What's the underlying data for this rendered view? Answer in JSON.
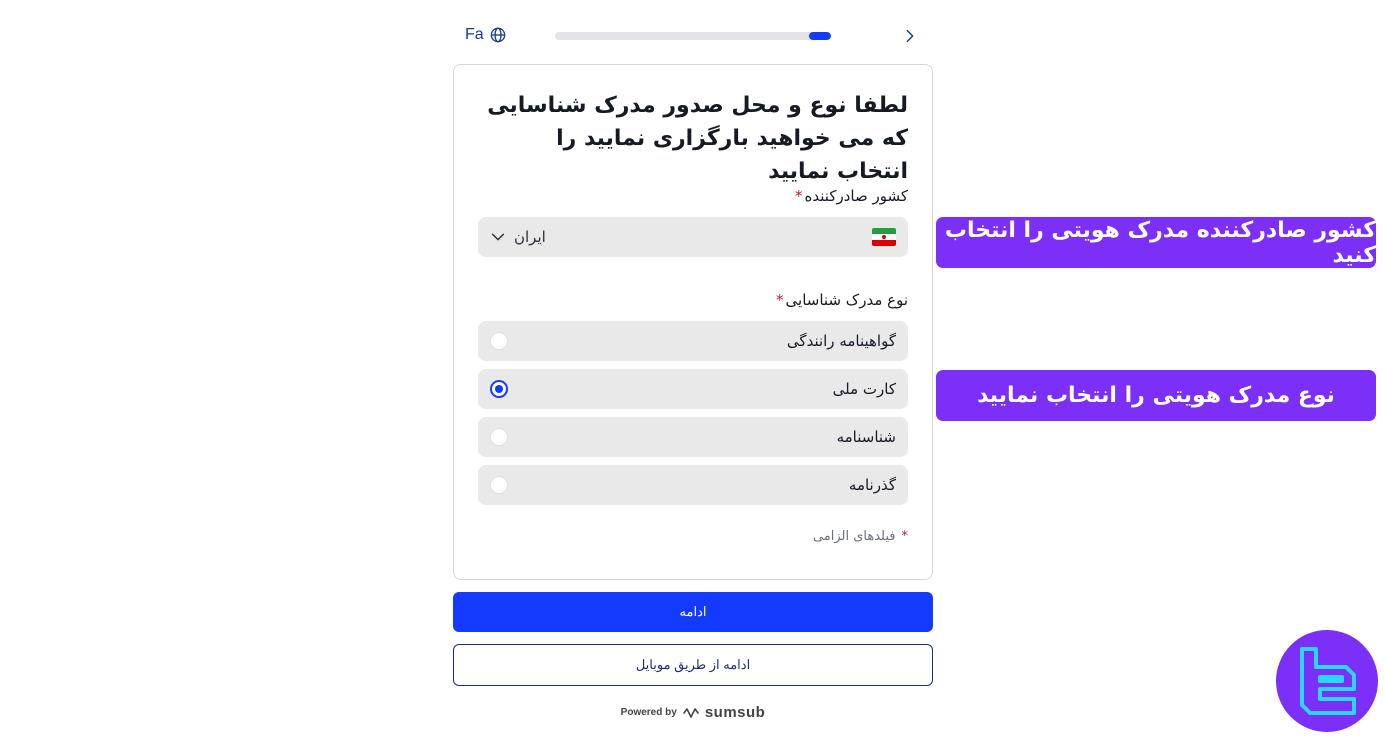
{
  "header": {
    "language_label": "Fa",
    "language_icon": "globe-icon",
    "back_icon": "chevron-right-icon",
    "progress_fraction": 0.08
  },
  "card": {
    "title": "لطفا نوع و محل صدور مدرک شناسایی که می خواهید بارگزاری نمایید را انتخاب نمایید",
    "country_label": "کشور صادرکننده",
    "country_value": "ایران",
    "country_flag": "iran-flag",
    "document_type_label": "نوع مدرک شناسایی",
    "required_mark": "*",
    "document_options": [
      {
        "label": "گواهینامه رانندگی",
        "selected": false
      },
      {
        "label": "کارت ملی",
        "selected": true
      },
      {
        "label": "شناسنامه",
        "selected": false
      },
      {
        "label": "گذرنامه",
        "selected": false
      }
    ],
    "required_note": "فیلدهای الزامی"
  },
  "actions": {
    "continue_label": "ادامه",
    "continue_mobile_label": "ادامه از طریق موبایل"
  },
  "footer": {
    "powered_by": "Powered by",
    "brand": "sumsub"
  },
  "annotations": {
    "select_country": "کشور صادرکننده مدرک هویتی را انتخاب کنید",
    "select_document_type": "نوع مدرک هویتی را انتخاب نمایید"
  },
  "colors": {
    "accent": "#1439ff",
    "callout": "#7b2ff7",
    "option_bg": "#e9e9ea",
    "required": "#c0192e"
  }
}
